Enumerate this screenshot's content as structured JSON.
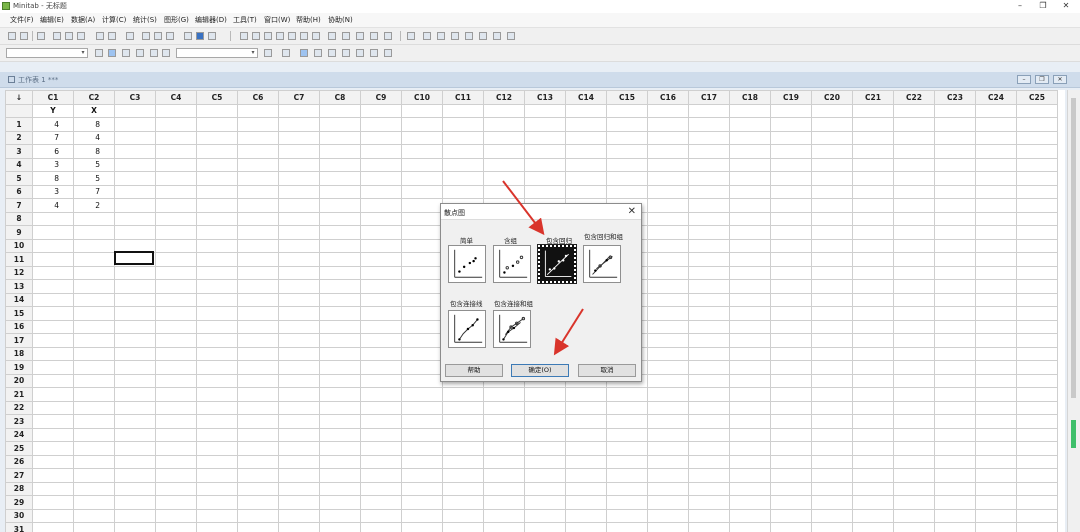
{
  "window": {
    "title": "Minitab - 无标题",
    "minimize": "–",
    "restore": "❐",
    "close": "✕"
  },
  "menu": [
    {
      "label": "文件(F)"
    },
    {
      "label": "编辑(E)"
    },
    {
      "label": "数据(A)"
    },
    {
      "label": "计算(C)"
    },
    {
      "label": "统计(S)"
    },
    {
      "label": "图形(G)"
    },
    {
      "label": "编辑器(D)"
    },
    {
      "label": "工具(T)"
    },
    {
      "label": "窗口(W)"
    },
    {
      "label": "帮助(H)"
    },
    {
      "label": "协助(N)"
    }
  ],
  "worksheet": {
    "title": "工作表 1 ***",
    "corner": "↓",
    "columns": [
      "C1",
      "C2",
      "C3",
      "C4",
      "C5",
      "C6",
      "C7",
      "C8",
      "C9",
      "C10",
      "C11",
      "C12",
      "C13",
      "C14",
      "C15",
      "C16",
      "C17",
      "C18",
      "C19",
      "C20",
      "C21",
      "C22",
      "C23",
      "C24",
      "C25"
    ],
    "names": [
      "Y",
      "X"
    ],
    "rows": [
      [
        "4",
        "8"
      ],
      [
        "7",
        "4"
      ],
      [
        "6",
        "8"
      ],
      [
        "3",
        "5"
      ],
      [
        "8",
        "5"
      ],
      [
        "3",
        "7"
      ],
      [
        "4",
        "2"
      ]
    ],
    "row_numbers": [
      "1",
      "2",
      "3",
      "4",
      "5",
      "6",
      "7",
      "8",
      "9",
      "10",
      "11",
      "12",
      "13",
      "14",
      "15",
      "16",
      "17",
      "18",
      "19",
      "20",
      "21",
      "22",
      "23",
      "24",
      "25",
      "26",
      "27",
      "28",
      "29",
      "30",
      "31"
    ]
  },
  "dialog": {
    "title": "散点图",
    "options": [
      {
        "label": "简单",
        "icon": "scatter-simple-icon"
      },
      {
        "label": "含组",
        "icon": "scatter-groups-icon"
      },
      {
        "label": "包含回归",
        "icon": "scatter-regression-icon",
        "selected": true
      },
      {
        "label": "包含回归和组",
        "icon": "scatter-regression-groups-icon"
      },
      {
        "label": "包含连接线",
        "icon": "scatter-connect-icon"
      },
      {
        "label": "包含连接和组",
        "icon": "scatter-connect-groups-icon"
      }
    ],
    "buttons": {
      "help": "帮助",
      "ok": "确定(O)",
      "cancel": "取消"
    }
  },
  "colors": {
    "arrow": "#d9342b",
    "header_bg": "#f2f2f2",
    "mdi_bg": "#e8eef5"
  }
}
